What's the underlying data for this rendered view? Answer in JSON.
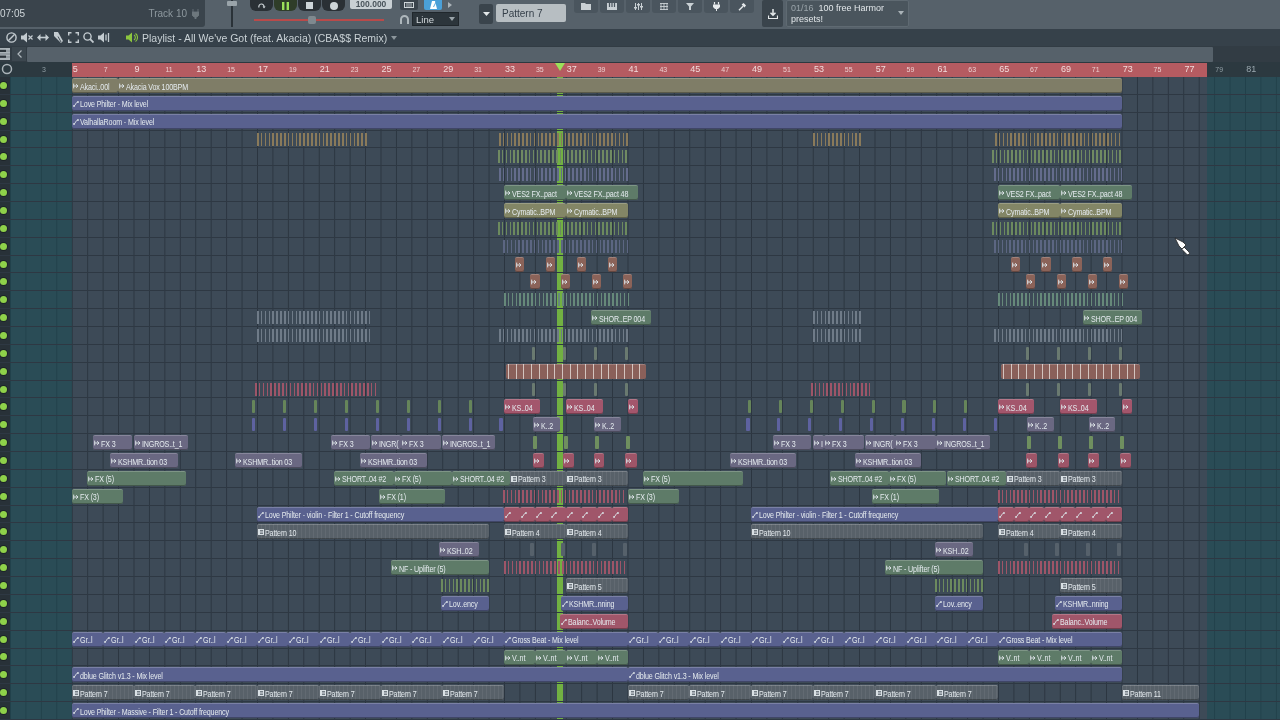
{
  "toolbar": {
    "time": "07:05",
    "track": "Track 10",
    "master_volume": {
      "level": 0.95
    },
    "transport": [
      {
        "kind": "loop",
        "selected": false
      },
      {
        "kind": "pause",
        "selected": true
      },
      {
        "kind": "stop",
        "selected": false
      },
      {
        "kind": "record",
        "selected": false
      }
    ],
    "tempo": "100.000",
    "master_pitch": {
      "level": 0.44
    },
    "toggles": [
      {
        "kind": "keyboard",
        "selected": false
      },
      {
        "kind": "metronome",
        "selected": true
      }
    ],
    "snap": "Line",
    "pattern": "Pattern 7",
    "hint": {
      "counter": "01/16",
      "text": "100 free Harmor presets!"
    }
  },
  "playlist": {
    "title": "Playlist - All We've Got (feat. Akacia) (CBA$$ Remix)",
    "ruler": {
      "labels": [
        "3",
        "5",
        "7",
        "9",
        "11",
        "13",
        "15",
        "17",
        "19",
        "21",
        "23",
        "25",
        "27",
        "29",
        "31",
        "33",
        "35",
        "37",
        "39",
        "41",
        "43",
        "45",
        "47",
        "49",
        "51",
        "53",
        "55",
        "57",
        "59",
        "61",
        "63",
        "65",
        "67",
        "69",
        "71",
        "73",
        "75",
        "77",
        "79",
        "81"
      ]
    },
    "tracks": [
      {
        "enabled": true,
        "clips": [
          {
            "kind": "audio",
            "label": "Akaci..00l",
            "color": "#7f7d67"
          },
          {
            "kind": "audio",
            "label": "Akacia Vox 100BPM",
            "color": "#7f7d67"
          }
        ]
      },
      {
        "enabled": true,
        "clips": [
          {
            "kind": "automation",
            "label": "Love Philter - Mix level",
            "color": "#59618f"
          }
        ]
      },
      {
        "enabled": true,
        "clips": [
          {
            "kind": "automation",
            "label": "ValhallaRoom - Mix level",
            "color": "#59618f"
          }
        ]
      },
      {
        "enabled": true,
        "clips": [
          {
            "kind": "strip",
            "color": "#8a7a5a"
          },
          {
            "kind": "strip",
            "color": "#8a7a5a"
          },
          {
            "kind": "strip",
            "color": "#8a7a5a"
          },
          {
            "kind": "strip",
            "color": "#8a7a5a"
          }
        ]
      },
      {
        "enabled": true,
        "clips": [
          {
            "kind": "strip",
            "color": "#708a62"
          },
          {
            "kind": "strip",
            "color": "#708a62"
          }
        ]
      },
      {
        "enabled": true,
        "clips": [
          {
            "kind": "strip",
            "color": "#646c8c"
          },
          {
            "kind": "strip",
            "color": "#646c8c"
          }
        ]
      },
      {
        "enabled": true,
        "clips": [
          {
            "kind": "audio",
            "label": "VES2 FX..pact",
            "color": "#5e7b68"
          },
          {
            "kind": "audio",
            "label": "VES2 FX..pact 48",
            "color": "#5e7b68"
          },
          {
            "kind": "audio",
            "label": "VES2 FX..pact",
            "color": "#5e7b68"
          },
          {
            "kind": "audio",
            "label": "VES2 FX..pact 48",
            "color": "#5e7b68"
          }
        ]
      },
      {
        "enabled": true,
        "clips": [
          {
            "kind": "audio",
            "label": "Cymatic..BPM",
            "color": "#838666"
          },
          {
            "kind": "audio",
            "label": "Cymatic..BPM",
            "color": "#838666"
          },
          {
            "kind": "audio",
            "label": "Cymatic..BPM",
            "color": "#838666"
          },
          {
            "kind": "audio",
            "label": "Cymatic..BPM",
            "color": "#838666"
          }
        ]
      },
      {
        "enabled": true,
        "clips": [
          {
            "kind": "strip",
            "color": "#6c8a5e"
          },
          {
            "kind": "strip",
            "color": "#6c8a5e"
          }
        ]
      },
      {
        "enabled": true,
        "clips": [
          {
            "kind": "strip",
            "color": "#5c6682"
          },
          {
            "kind": "strip",
            "color": "#5c6682"
          }
        ]
      },
      {
        "enabled": true,
        "clips": [
          {
            "kind": "audio",
            "color": "#8b6359"
          },
          {
            "kind": "audio",
            "color": "#8b6359"
          },
          {
            "kind": "audio",
            "color": "#8b6359"
          },
          {
            "kind": "audio",
            "color": "#8b6359"
          },
          {
            "kind": "audio",
            "color": "#8b6359"
          },
          {
            "kind": "audio",
            "color": "#8b6359"
          },
          {
            "kind": "audio",
            "color": "#8b6359"
          },
          {
            "kind": "audio",
            "color": "#8b6359"
          }
        ]
      },
      {
        "enabled": true,
        "clips": [
          {
            "kind": "audio",
            "color": "#8b6359"
          },
          {
            "kind": "audio",
            "color": "#8b6359"
          },
          {
            "kind": "audio",
            "color": "#8b6359"
          },
          {
            "kind": "audio",
            "color": "#8b6359"
          },
          {
            "kind": "audio",
            "color": "#8b6359"
          },
          {
            "kind": "audio",
            "color": "#8b6359"
          },
          {
            "kind": "audio",
            "color": "#8b6359"
          },
          {
            "kind": "audio",
            "color": "#8b6359"
          }
        ]
      },
      {
        "enabled": true,
        "clips": [
          {
            "kind": "strip",
            "color": "#66897a"
          },
          {
            "kind": "strip",
            "color": "#66897a"
          }
        ]
      },
      {
        "enabled": true,
        "clips": [
          {
            "kind": "strip",
            "color": "#6f7b88"
          },
          {
            "kind": "audio",
            "label": "SHOR..EP 004",
            "color": "#5e7b68"
          },
          {
            "kind": "strip",
            "color": "#6f7b88"
          },
          {
            "kind": "audio",
            "label": "SHOR..EP 004",
            "color": "#5e7b68"
          }
        ]
      },
      {
        "enabled": true,
        "clips": [
          {
            "kind": "strip",
            "color": "#6f7b88"
          },
          {
            "kind": "strip",
            "color": "#6f7b88"
          },
          {
            "kind": "strip",
            "color": "#6f7b88"
          },
          {
            "kind": "strip",
            "color": "#6f7b88"
          }
        ]
      },
      {
        "enabled": true,
        "clips": [
          {
            "kind": "tick",
            "color": "#6a7a70"
          },
          {
            "kind": "tick",
            "color": "#6a7a70"
          },
          {
            "kind": "tick",
            "color": "#6a7a70"
          },
          {
            "kind": "tick",
            "color": "#6a7a70"
          },
          {
            "kind": "tick",
            "color": "#6a7a70"
          },
          {
            "kind": "tick",
            "color": "#6a7a70"
          },
          {
            "kind": "tick",
            "color": "#6a7a70"
          },
          {
            "kind": "tick",
            "color": "#6a7a70"
          }
        ]
      },
      {
        "enabled": true,
        "clips": [
          {
            "kind": "run",
            "color": "#8a605a"
          },
          {
            "kind": "run",
            "color": "#8a605a"
          }
        ]
      },
      {
        "enabled": true,
        "clips": [
          {
            "kind": "strip",
            "color": "#9e5568"
          },
          {
            "kind": "tick",
            "color": "#6a7a70"
          },
          {
            "kind": "tick",
            "color": "#6a7a70"
          },
          {
            "kind": "tick",
            "color": "#6a7a70"
          },
          {
            "kind": "tick",
            "color": "#6a7a70"
          },
          {
            "kind": "strip",
            "color": "#9e5568"
          },
          {
            "kind": "tick",
            "color": "#6a7a70"
          },
          {
            "kind": "tick",
            "color": "#6a7a70"
          },
          {
            "kind": "tick",
            "color": "#6a7a70"
          },
          {
            "kind": "tick",
            "color": "#6a7a70"
          }
        ]
      },
      {
        "enabled": true,
        "clips": [
          {
            "kind": "tick",
            "color": "#66855a"
          },
          {
            "kind": "tick",
            "color": "#66855a"
          },
          {
            "kind": "tick",
            "color": "#66855a"
          },
          {
            "kind": "tick",
            "color": "#66855a"
          },
          {
            "kind": "tick",
            "color": "#66855a"
          },
          {
            "kind": "tick",
            "color": "#66855a"
          },
          {
            "kind": "tick",
            "color": "#66855a"
          },
          {
            "kind": "tick",
            "color": "#66855a"
          },
          {
            "kind": "audio",
            "label": "KS..04",
            "color": "#a3566c"
          },
          {
            "kind": "audio",
            "label": "KS..04",
            "color": "#a3566c"
          },
          {
            "kind": "audio",
            "color": "#a3566c"
          },
          {
            "kind": "tick",
            "color": "#66855a"
          },
          {
            "kind": "tick",
            "color": "#66855a"
          },
          {
            "kind": "tick",
            "color": "#66855a"
          },
          {
            "kind": "tick",
            "color": "#66855a"
          },
          {
            "kind": "tick",
            "color": "#66855a"
          },
          {
            "kind": "tick",
            "color": "#66855a"
          },
          {
            "kind": "tick",
            "color": "#66855a"
          },
          {
            "kind": "tick",
            "color": "#66855a"
          },
          {
            "kind": "audio",
            "label": "KS..04",
            "color": "#a3566c"
          },
          {
            "kind": "audio",
            "label": "KS..04",
            "color": "#a3566c"
          },
          {
            "kind": "audio",
            "color": "#a3566c"
          }
        ]
      },
      {
        "enabled": true,
        "clips": [
          {
            "kind": "tick",
            "color": "#5e62a0"
          },
          {
            "kind": "tick",
            "color": "#5e62a0"
          },
          {
            "kind": "tick",
            "color": "#5e62a0"
          },
          {
            "kind": "tick",
            "color": "#5e62a0"
          },
          {
            "kind": "tick",
            "color": "#5e62a0"
          },
          {
            "kind": "tick",
            "color": "#5e62a0"
          },
          {
            "kind": "tick",
            "color": "#5e62a0"
          },
          {
            "kind": "tick",
            "color": "#5e62a0"
          },
          {
            "kind": "tick",
            "color": "#5e62a0"
          },
          {
            "kind": "audio",
            "label": "K..2",
            "color": "#6a6882"
          },
          {
            "kind": "audio",
            "label": "K..2",
            "color": "#6a6882"
          },
          {
            "kind": "tick",
            "color": "#5e62a0"
          },
          {
            "kind": "tick",
            "color": "#5e62a0"
          },
          {
            "kind": "tick",
            "color": "#5e62a0"
          },
          {
            "kind": "tick",
            "color": "#5e62a0"
          },
          {
            "kind": "tick",
            "color": "#5e62a0"
          },
          {
            "kind": "tick",
            "color": "#5e62a0"
          },
          {
            "kind": "tick",
            "color": "#5e62a0"
          },
          {
            "kind": "tick",
            "color": "#5e62a0"
          },
          {
            "kind": "tick",
            "color": "#5e62a0"
          },
          {
            "kind": "audio",
            "label": "K..2",
            "color": "#6a6882"
          },
          {
            "kind": "audio",
            "label": "K..2",
            "color": "#6a6882"
          }
        ]
      },
      {
        "enabled": true,
        "clips": [
          {
            "kind": "audio",
            "label": "FX 3",
            "color": "#6a6882"
          },
          {
            "kind": "audio",
            "label": "INGROS..t_1",
            "color": "#6a6882"
          },
          {
            "kind": "audio",
            "label": "FX 3",
            "color": "#6a6882"
          },
          {
            "kind": "audio",
            "label": "INGR(",
            "color": "#6a6882"
          },
          {
            "kind": "audio",
            "label": "FX 3",
            "color": "#6a6882"
          },
          {
            "kind": "audio",
            "label": "INGROS..t_1",
            "color": "#6a6882"
          },
          {
            "kind": "tick",
            "color": "#6f8f5f"
          },
          {
            "kind": "tick",
            "color": "#6f8f5f"
          },
          {
            "kind": "tick",
            "color": "#6f8f5f"
          },
          {
            "kind": "tick",
            "color": "#6f8f5f"
          },
          {
            "kind": "audio",
            "label": "FX 3",
            "color": "#6a6882"
          },
          {
            "kind": "audio",
            "label": "I",
            "color": "#6a6882"
          },
          {
            "kind": "audio",
            "label": "FX 3",
            "color": "#6a6882"
          },
          {
            "kind": "audio",
            "label": "INGR(",
            "color": "#6a6882"
          },
          {
            "kind": "audio",
            "label": "FX 3",
            "color": "#6a6882"
          },
          {
            "kind": "audio",
            "label": "INGROS..t_1",
            "color": "#6a6882"
          },
          {
            "kind": "tick",
            "color": "#6f8f5f"
          },
          {
            "kind": "tick",
            "color": "#6f8f5f"
          },
          {
            "kind": "tick",
            "color": "#6f8f5f"
          },
          {
            "kind": "tick",
            "color": "#6f8f5f"
          }
        ]
      },
      {
        "enabled": true,
        "clips": [
          {
            "kind": "audio",
            "label": "KSHMR..tion 03",
            "color": "#6a6882"
          },
          {
            "kind": "audio",
            "label": "KSHMR..tion 03",
            "color": "#6a6882"
          },
          {
            "kind": "audio",
            "label": "KSHMR..tion 03",
            "color": "#6a6882"
          },
          {
            "kind": "audio",
            "color": "#9e5568"
          },
          {
            "kind": "audio",
            "color": "#9e5568"
          },
          {
            "kind": "audio",
            "color": "#9e5568"
          },
          {
            "kind": "audio",
            "color": "#9e5568"
          },
          {
            "kind": "audio",
            "label": "KSHMR..tion 03",
            "color": "#6a6882"
          },
          {
            "kind": "audio",
            "label": "KSHMR..tion 03",
            "color": "#6a6882"
          },
          {
            "kind": "audio",
            "color": "#9e5568"
          },
          {
            "kind": "audio",
            "color": "#9e5568"
          },
          {
            "kind": "audio",
            "color": "#9e5568"
          },
          {
            "kind": "audio",
            "color": "#9e5568"
          }
        ]
      },
      {
        "enabled": true,
        "clips": [
          {
            "kind": "audio",
            "label": "FX (5)",
            "color": "#5e7b68"
          },
          {
            "kind": "audio",
            "label": "SHORT..04 #2",
            "color": "#5e7b68"
          },
          {
            "kind": "audio",
            "label": "FX (5)",
            "color": "#5e7b68"
          },
          {
            "kind": "audio",
            "label": "SHORT..04 #2",
            "color": "#5e7b68"
          },
          {
            "kind": "pattern",
            "label": "Pattern 3",
            "color": "#586169"
          },
          {
            "kind": "pattern",
            "label": "Pattern 3",
            "color": "#586169"
          },
          {
            "kind": "audio",
            "label": "FX (5)",
            "color": "#5e7b68"
          },
          {
            "kind": "audio",
            "label": "SHORT..04 #2",
            "color": "#5e7b68"
          },
          {
            "kind": "audio",
            "label": "FX (5)",
            "color": "#5e7b68"
          },
          {
            "kind": "audio",
            "label": "SHORT..04 #2",
            "color": "#5e7b68"
          },
          {
            "kind": "pattern",
            "label": "Pattern 3",
            "color": "#586169"
          },
          {
            "kind": "pattern",
            "label": "Pattern 3",
            "color": "#586169"
          }
        ]
      },
      {
        "enabled": true,
        "clips": [
          {
            "kind": "audio",
            "label": "FX (3)",
            "color": "#5e7b68"
          },
          {
            "kind": "audio",
            "label": "FX (1)",
            "color": "#5e7b68"
          },
          {
            "kind": "strip",
            "color": "#9e5568"
          },
          {
            "kind": "audio",
            "label": "FX (3)",
            "color": "#5e7b68"
          },
          {
            "kind": "audio",
            "label": "FX (1)",
            "color": "#5e7b68"
          },
          {
            "kind": "strip",
            "color": "#9e5568"
          }
        ]
      },
      {
        "enabled": true,
        "clips": [
          {
            "kind": "automation",
            "label": "Love Philter - violin - Filter 1 - Cutoff frequency",
            "color": "#59618f"
          },
          {
            "kind": "automation",
            "color": "#a0566a"
          },
          {
            "kind": "automation",
            "color": "#a0566a"
          },
          {
            "kind": "automation",
            "color": "#a0566a"
          },
          {
            "kind": "automation",
            "color": "#a0566a"
          },
          {
            "kind": "automation",
            "color": "#a0566a"
          },
          {
            "kind": "automation",
            "color": "#a0566a"
          },
          {
            "kind": "automation",
            "color": "#a0566a"
          },
          {
            "kind": "automation",
            "color": "#a0566a"
          },
          {
            "kind": "automation",
            "label": "Love Philter - violin - Filter 1 - Cutoff frequency",
            "color": "#59618f"
          },
          {
            "kind": "automation",
            "color": "#a0566a"
          },
          {
            "kind": "automation",
            "color": "#a0566a"
          },
          {
            "kind": "automation",
            "color": "#a0566a"
          },
          {
            "kind": "automation",
            "color": "#a0566a"
          },
          {
            "kind": "automation",
            "color": "#a0566a"
          },
          {
            "kind": "automation",
            "color": "#a0566a"
          },
          {
            "kind": "automation",
            "color": "#a0566a"
          },
          {
            "kind": "automation",
            "color": "#a0566a"
          }
        ]
      },
      {
        "enabled": true,
        "clips": [
          {
            "kind": "pattern",
            "label": "Pattern 10",
            "color": "#586169"
          },
          {
            "kind": "pattern",
            "label": "Pattern 4",
            "color": "#586169"
          },
          {
            "kind": "pattern",
            "label": "Pattern 4",
            "color": "#586169"
          },
          {
            "kind": "pattern",
            "label": "Pattern 10",
            "color": "#586169"
          },
          {
            "kind": "pattern",
            "label": "Pattern 4",
            "color": "#586169"
          },
          {
            "kind": "pattern",
            "label": "Pattern 4",
            "color": "#586169"
          }
        ]
      },
      {
        "enabled": true,
        "clips": [
          {
            "kind": "audio",
            "label": "KSH..02",
            "color": "#6a6882"
          },
          {
            "kind": "tick",
            "color": "#56616b"
          },
          {
            "kind": "tick",
            "color": "#56616b"
          },
          {
            "kind": "tick",
            "color": "#56616b"
          },
          {
            "kind": "tick",
            "color": "#56616b"
          },
          {
            "kind": "audio",
            "label": "KSH..02",
            "color": "#6a6882"
          },
          {
            "kind": "tick",
            "color": "#56616b"
          },
          {
            "kind": "tick",
            "color": "#56616b"
          },
          {
            "kind": "tick",
            "color": "#56616b"
          },
          {
            "kind": "tick",
            "color": "#56616b"
          }
        ]
      },
      {
        "enabled": true,
        "clips": [
          {
            "kind": "audio",
            "label": "NF - Uplifter  (5)",
            "color": "#5e7b68"
          },
          {
            "kind": "strip",
            "color": "#9e5568"
          },
          {
            "kind": "audio",
            "label": "NF - Uplifter  (5)",
            "color": "#5e7b68"
          },
          {
            "kind": "strip",
            "color": "#9e5568"
          }
        ]
      },
      {
        "enabled": true,
        "clips": [
          {
            "kind": "strip",
            "color": "#6c8a5e"
          },
          {
            "kind": "pattern",
            "label": "Pattern 5",
            "color": "#586169"
          },
          {
            "kind": "strip",
            "color": "#6c8a5e"
          },
          {
            "kind": "pattern",
            "label": "Pattern 5",
            "color": "#586169"
          }
        ]
      },
      {
        "enabled": true,
        "clips": [
          {
            "kind": "automation",
            "label": "Lov..ency",
            "color": "#59618f"
          },
          {
            "kind": "automation",
            "label": "KSHMR..nning",
            "color": "#59618f"
          },
          {
            "kind": "automation",
            "label": "Lov..ency",
            "color": "#59618f"
          },
          {
            "kind": "automation",
            "label": "KSHMR..nning",
            "color": "#59618f"
          }
        ]
      },
      {
        "enabled": true,
        "clips": [
          {
            "kind": "automation",
            "label": "Balanc..Volume",
            "color": "#a0566a"
          },
          {
            "kind": "automation",
            "label": "Balanc..Volume",
            "color": "#a0566a"
          }
        ]
      },
      {
        "enabled": true,
        "clips": [
          {
            "kind": "automation",
            "label": "Gr..l",
            "color": "#59618f"
          },
          {
            "kind": "automation",
            "label": "Gr..l",
            "color": "#59618f"
          },
          {
            "kind": "automation",
            "label": "Gr..l",
            "color": "#59618f"
          },
          {
            "kind": "automation",
            "label": "Gr..l",
            "color": "#59618f"
          },
          {
            "kind": "automation",
            "label": "Gr..l",
            "color": "#59618f"
          },
          {
            "kind": "automation",
            "label": "Gr..l",
            "color": "#59618f"
          },
          {
            "kind": "automation",
            "label": "Gr..l",
            "color": "#59618f"
          },
          {
            "kind": "automation",
            "label": "Gr..l",
            "color": "#59618f"
          },
          {
            "kind": "automation",
            "label": "Gr..l",
            "color": "#59618f"
          },
          {
            "kind": "automation",
            "label": "Gr..l",
            "color": "#59618f"
          },
          {
            "kind": "automation",
            "label": "Gr..l",
            "color": "#59618f"
          },
          {
            "kind": "automation",
            "label": "Gr..l",
            "color": "#59618f"
          },
          {
            "kind": "automation",
            "label": "Gr..l",
            "color": "#59618f"
          },
          {
            "kind": "automation",
            "label": "Gr..l",
            "color": "#59618f"
          },
          {
            "kind": "automation",
            "label": "Gross Beat - Mix level",
            "color": "#59618f"
          },
          {
            "kind": "automation",
            "label": "Gr..l",
            "color": "#59618f"
          },
          {
            "kind": "automation",
            "label": "Gr..l",
            "color": "#59618f"
          },
          {
            "kind": "automation",
            "label": "Gr..l",
            "color": "#59618f"
          },
          {
            "kind": "automation",
            "label": "Gr..l",
            "color": "#59618f"
          },
          {
            "kind": "automation",
            "label": "Gr..l",
            "color": "#59618f"
          },
          {
            "kind": "automation",
            "label": "Gr..l",
            "color": "#59618f"
          },
          {
            "kind": "automation",
            "label": "Gr..l",
            "color": "#59618f"
          },
          {
            "kind": "automation",
            "label": "Gr..l",
            "color": "#59618f"
          },
          {
            "kind": "automation",
            "label": "Gr..l",
            "color": "#59618f"
          },
          {
            "kind": "automation",
            "label": "Gr..l",
            "color": "#59618f"
          },
          {
            "kind": "automation",
            "label": "Gr..l",
            "color": "#59618f"
          },
          {
            "kind": "automation",
            "label": "Gr..l",
            "color": "#59618f"
          },
          {
            "kind": "automation",
            "label": "Gross Beat - Mix level",
            "color": "#59618f"
          }
        ]
      },
      {
        "enabled": true,
        "clips": [
          {
            "kind": "audio",
            "label": "V..nt",
            "color": "#5e7b68"
          },
          {
            "kind": "audio",
            "label": "V..nt",
            "color": "#5e7b68"
          },
          {
            "kind": "audio",
            "label": "V..nt",
            "color": "#5e7b68"
          },
          {
            "kind": "audio",
            "label": "V..nt",
            "color": "#5e7b68"
          },
          {
            "kind": "audio",
            "label": "V..nt",
            "color": "#5e7b68"
          },
          {
            "kind": "audio",
            "label": "V..nt",
            "color": "#5e7b68"
          },
          {
            "kind": "audio",
            "label": "V..nt",
            "color": "#5e7b68"
          },
          {
            "kind": "audio",
            "label": "V..nt",
            "color": "#5e7b68"
          }
        ]
      },
      {
        "enabled": true,
        "clips": [
          {
            "kind": "automation",
            "label": "dblue Glitch v1.3 - Mix level",
            "color": "#59618f"
          },
          {
            "kind": "automation",
            "label": "dblue Glitch v1.3 - Mix level",
            "color": "#59618f"
          }
        ]
      },
      {
        "enabled": true,
        "clips": [
          {
            "kind": "pattern",
            "label": "Pattern 7",
            "color": "#586169"
          },
          {
            "kind": "pattern",
            "label": "Pattern 7",
            "color": "#586169"
          },
          {
            "kind": "pattern",
            "label": "Pattern 7",
            "color": "#586169"
          },
          {
            "kind": "pattern",
            "label": "Pattern 7",
            "color": "#586169"
          },
          {
            "kind": "pattern",
            "label": "Pattern 7",
            "color": "#586169"
          },
          {
            "kind": "pattern",
            "label": "Pattern 7",
            "color": "#586169"
          },
          {
            "kind": "pattern",
            "label": "Pattern 7",
            "color": "#586169"
          },
          {
            "kind": "pattern",
            "label": "Pattern 7",
            "color": "#586169"
          },
          {
            "kind": "pattern",
            "label": "Pattern 7",
            "color": "#586169"
          },
          {
            "kind": "pattern",
            "label": "Pattern 7",
            "color": "#586169"
          },
          {
            "kind": "pattern",
            "label": "Pattern 7",
            "color": "#586169"
          },
          {
            "kind": "pattern",
            "label": "Pattern 7",
            "color": "#586169"
          },
          {
            "kind": "pattern",
            "label": "Pattern 7",
            "color": "#586169"
          },
          {
            "kind": "pattern",
            "label": "Pattern 11",
            "color": "#586169"
          }
        ]
      },
      {
        "enabled": true,
        "clips": [
          {
            "kind": "automation",
            "label": "Love Philter - Massive - Filter 1 - Cutoff frequency",
            "color": "#59618f"
          }
        ]
      }
    ]
  }
}
